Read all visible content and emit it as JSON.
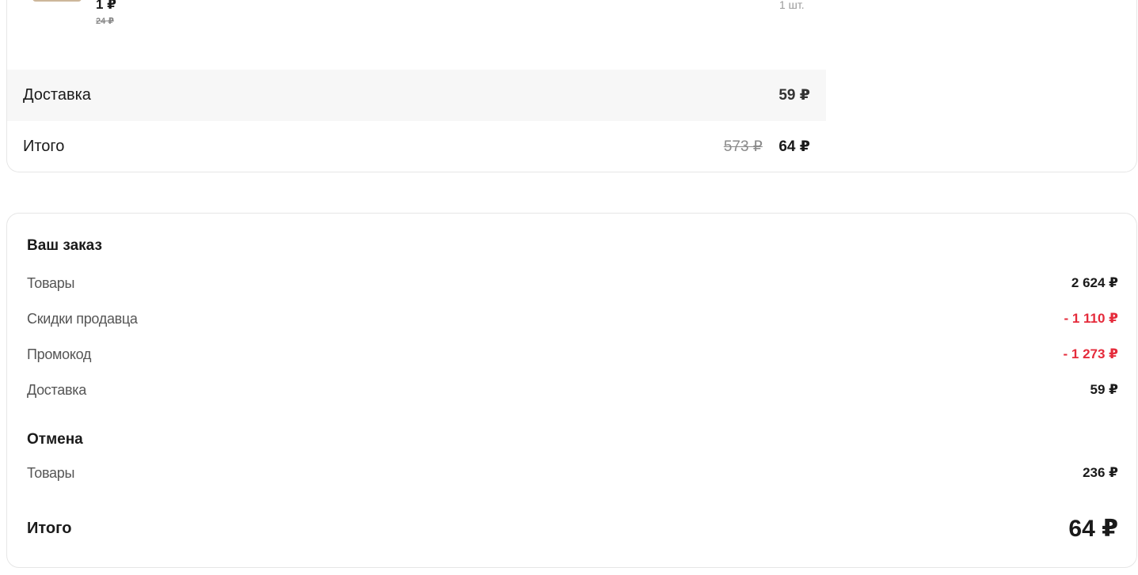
{
  "item": {
    "price": "1 ₽",
    "old_price": "24 ₽",
    "quantity": "1 шт."
  },
  "shipment_summary": {
    "delivery_label": "Доставка",
    "delivery_value": "59 ₽",
    "total_label": "Итого",
    "total_old": "573 ₽",
    "total_value": "64 ₽"
  },
  "order": {
    "title": "Ваш заказ",
    "lines": [
      {
        "label": "Товары",
        "value": "2 624 ₽"
      },
      {
        "label": "Скидки продавца",
        "value": "- 1 110 ₽"
      },
      {
        "label": "Промокод",
        "value": "- 1 273 ₽"
      },
      {
        "label": "Доставка",
        "value": "59 ₽"
      }
    ],
    "cancel_title": "Отмена",
    "cancel_lines": [
      {
        "label": "Товары",
        "value": "236 ₽"
      }
    ],
    "total_label": "Итого",
    "total_value": "64 ₽"
  },
  "colors": {
    "negative": "#e52b3b",
    "row_bg": "#f7f7f7",
    "border": "#e6e6e6"
  }
}
